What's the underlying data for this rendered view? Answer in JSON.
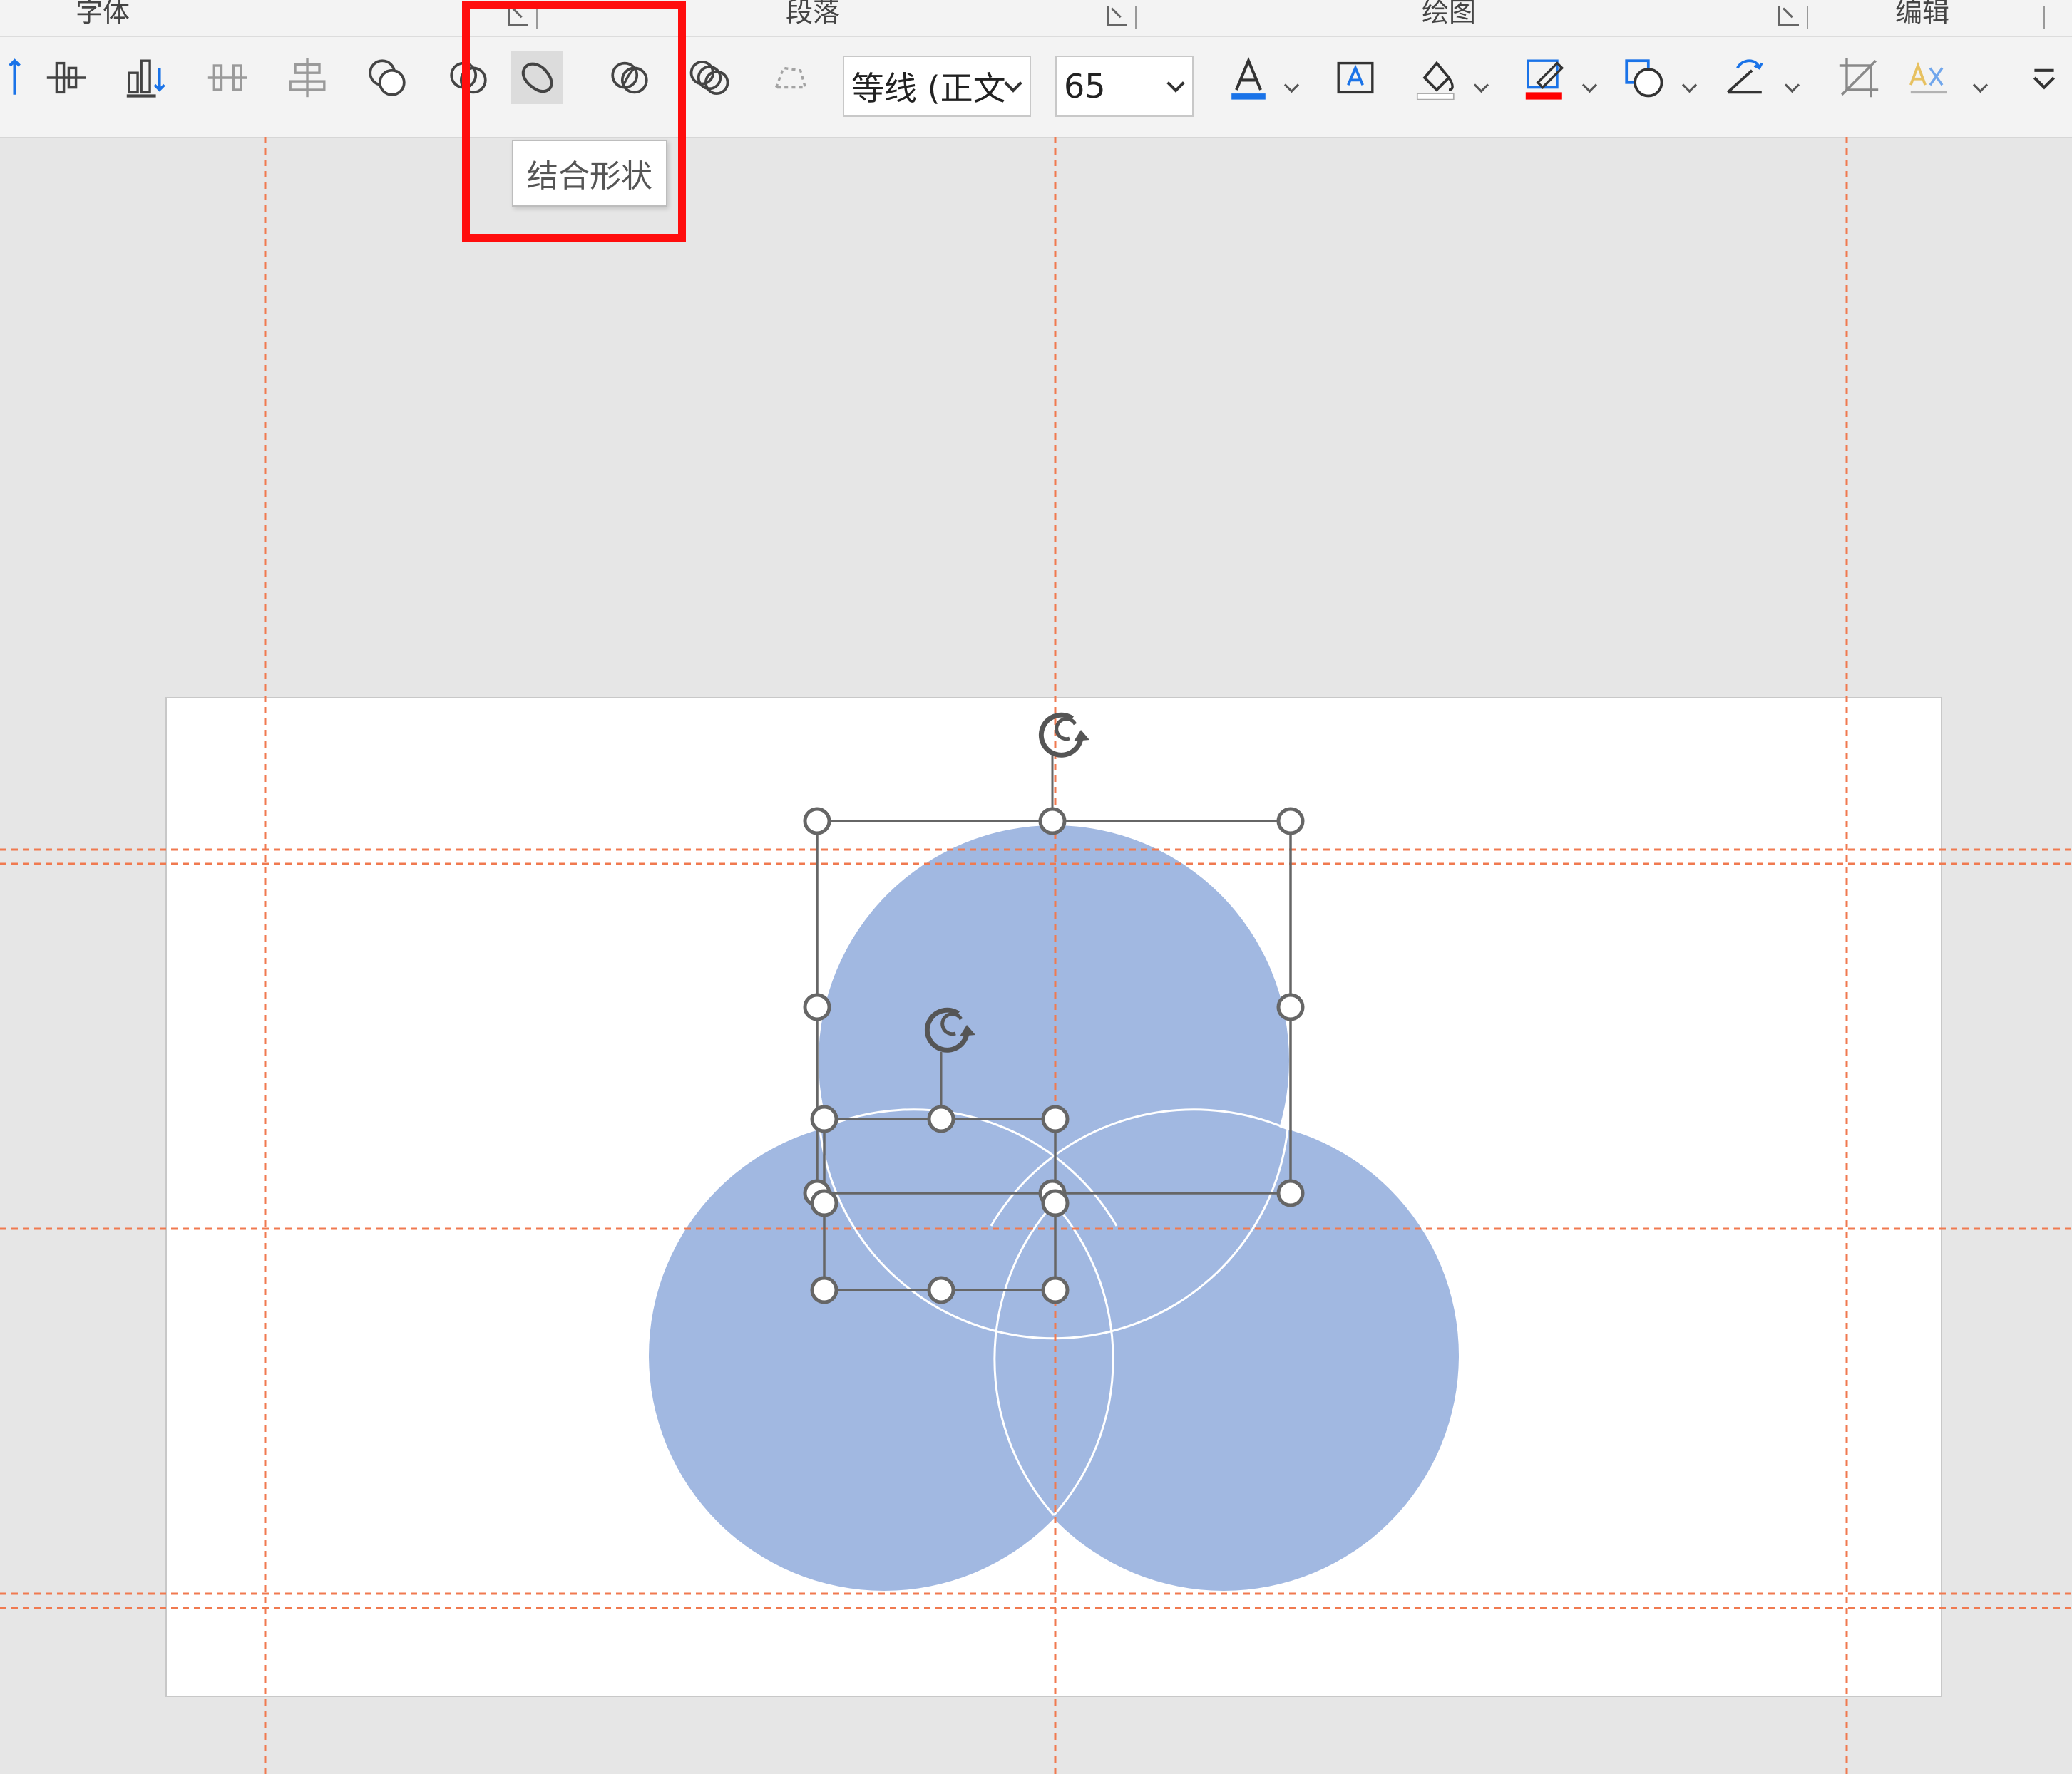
{
  "ribbon": {
    "group_labels": {
      "font": "字体",
      "paragraph": "段落",
      "drawing": "绘图",
      "editing": "编辑"
    },
    "font_name": "等线 (正文",
    "font_size": "65",
    "tooltip": "结合形状"
  },
  "colors": {
    "accent_highlight": "#ff0d0d",
    "shape_fill": "#a1b8e1",
    "guide_line": "#f07a50",
    "font_color_bar": "#1a73e8",
    "outline_color_bar": "#ff0000"
  },
  "icons": [
    "align-top-icon",
    "distribute-vertical-icon",
    "align-bottom-icon",
    "align-middle-icon",
    "align-center-icon",
    "union-shapes-icon",
    "fragment-shapes-icon",
    "combine-shapes-icon",
    "intersect-shapes-icon",
    "subtract-shapes-icon",
    "edit-points-icon",
    "font-color-icon",
    "text-box-icon",
    "shape-fill-icon",
    "shape-outline-icon",
    "shape-effects-icon",
    "rotate-icon",
    "crop-icon",
    "replace-icon",
    "more-icon"
  ]
}
